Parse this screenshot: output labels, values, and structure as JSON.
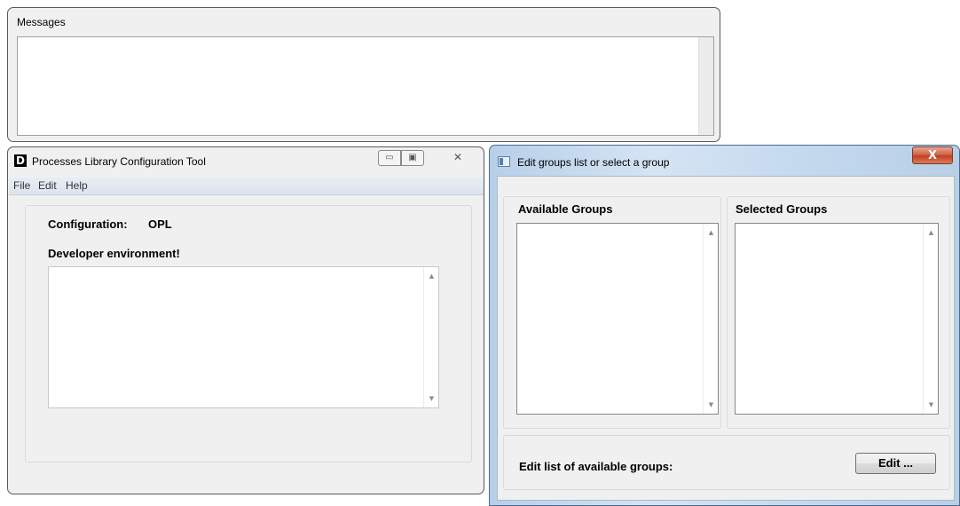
{
  "messages_window": {
    "label": "Messages"
  },
  "plct_window": {
    "logo_letter": "D",
    "title": "Processes Library Configuration Tool",
    "minimize_glyph": "▭",
    "maximize_glyph": "▣",
    "close_glyph": "✕",
    "menu": [
      "File",
      "Edit",
      "Help"
    ],
    "configuration_label": "Configuration:",
    "configuration_value": "OPL",
    "environment_text": "Developer environment!",
    "scroll_up_glyph": "▲",
    "scroll_down_glyph": "▼"
  },
  "groups_window": {
    "title": "Edit groups list or select a group",
    "close_glyph": "X",
    "available_header": "Available Groups",
    "selected_header": "Selected Groups",
    "available_items": [],
    "selected_items": [],
    "edit_list_label": "Edit list of available groups:",
    "edit_button_label": "Edit ..."
  },
  "colors": {
    "dialog_frame": "#b6cfe8",
    "close_button": "#c23e20",
    "menubar": "#e2e7f0"
  }
}
